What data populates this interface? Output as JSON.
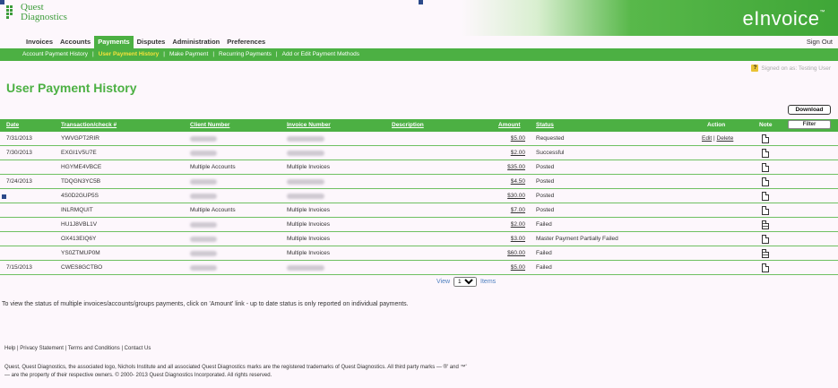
{
  "brand": {
    "logo_line1": "Quest",
    "logo_line2": "Diagnostics",
    "app_name": "eInvoice",
    "tm": "™"
  },
  "colors": {
    "accent_green": "#4cb043",
    "active_subnav": "#f6e23a",
    "title_green": "#4cb043"
  },
  "main_nav": {
    "items": [
      {
        "label": "Invoices",
        "active": false
      },
      {
        "label": "Accounts",
        "active": false
      },
      {
        "label": "Payments",
        "active": true
      },
      {
        "label": "Disputes",
        "active": false
      },
      {
        "label": "Administration",
        "active": false
      },
      {
        "label": "Preferences",
        "active": false
      }
    ],
    "sign_out": "Sign Out"
  },
  "sub_nav": {
    "items": [
      {
        "label": "Account Payment History",
        "active": false
      },
      {
        "label": "User Payment History",
        "active": true
      },
      {
        "label": "Make Payment",
        "active": false
      },
      {
        "label": "Recurring Payments",
        "active": false
      },
      {
        "label": "Add or Edit Payment Methods",
        "active": false
      }
    ],
    "separator": "|"
  },
  "signed_on": {
    "help_icon": "?",
    "text": "Signed on as: Testing User"
  },
  "page_title": "User Payment History",
  "download_label": "Download",
  "table": {
    "headers": {
      "date": "Date",
      "transaction": "Transaction/check #",
      "client": "Client Number",
      "invoice": "Invoice Number",
      "description": "Description",
      "amount": "Amount",
      "status": "Status",
      "action": "Action",
      "note": "Note"
    },
    "filter_label": "Filter",
    "rows": [
      {
        "date": "7/31/2013",
        "txn": "YWVGPT2RIR",
        "client": "",
        "invoice": "",
        "amount": "$5.00",
        "status": "Requested",
        "edit": "Edit",
        "sep": "|",
        "delete": "Delete",
        "note": "empty"
      },
      {
        "date": "7/30/2013",
        "txn": "EXGI1V5U7E",
        "client": "",
        "invoice": "",
        "amount": "$2.00",
        "status": "Successful",
        "note": "empty"
      },
      {
        "date": "",
        "txn": "HGYME4VBCE",
        "client": "Multiple Accounts",
        "invoice": "Multiple Invoices",
        "amount": "$35.00",
        "status": "Posted",
        "note": "empty"
      },
      {
        "date": "7/24/2013",
        "txn": "TDQGN3YC5B",
        "client": "",
        "invoice": "",
        "amount": "$4.50",
        "status": "Posted",
        "note": "empty"
      },
      {
        "date": "",
        "txn": "4S0D2GUP5S",
        "client": "",
        "invoice": "",
        "amount": "$30.00",
        "status": "Posted",
        "note": "empty"
      },
      {
        "date": "",
        "txn": "INLRMQUIT",
        "client": "Multiple Accounts",
        "invoice": "Multiple Invoices",
        "amount": "$7.00",
        "status": "Posted",
        "note": "empty"
      },
      {
        "date": "",
        "txn": "HU1J8VBL1V",
        "client": "",
        "invoice": "Multiple Invoices",
        "amount": "$2.00",
        "status": "Failed",
        "note": "filled"
      },
      {
        "date": "",
        "txn": "OX413EIQ6Y",
        "client": "",
        "invoice": "Multiple Invoices",
        "amount": "$3.00",
        "status": "Master Payment Partially Failed",
        "note": "empty"
      },
      {
        "date": "",
        "txn": "YS0ZTMUP0M",
        "client": "",
        "invoice": "Multiple Invoices",
        "amount": "$60.00",
        "status": "Failed",
        "note": "filled"
      },
      {
        "date": "7/15/2013",
        "txn": "CWES8GCTBO",
        "client": "",
        "invoice": "",
        "amount": "$5.00",
        "status": "Failed",
        "note": "empty"
      }
    ]
  },
  "pager": {
    "view_label": "View",
    "page_size": "10",
    "items_label": "Items"
  },
  "info_text": "To view the status of multiple invoices/accounts/groups payments, click on 'Amount' link - up to date status is only reported on individual payments.",
  "footer": {
    "help": "Help",
    "privacy": "Privacy Statement",
    "terms": "Terms and Conditions",
    "contact": "Contact Us",
    "sep": "|",
    "legal_line1": "Quest, Quest Diagnostics, the associated logo, Nichols Institute and all associated Quest Diagnostics marks are the registered trademarks of Quest Diagnostics. All third party marks — ®' and ™'",
    "legal_line2": "— are the property of their respective owners. © 2000- 2013 Quest Diagnostics Incorporated. All rights reserved."
  }
}
